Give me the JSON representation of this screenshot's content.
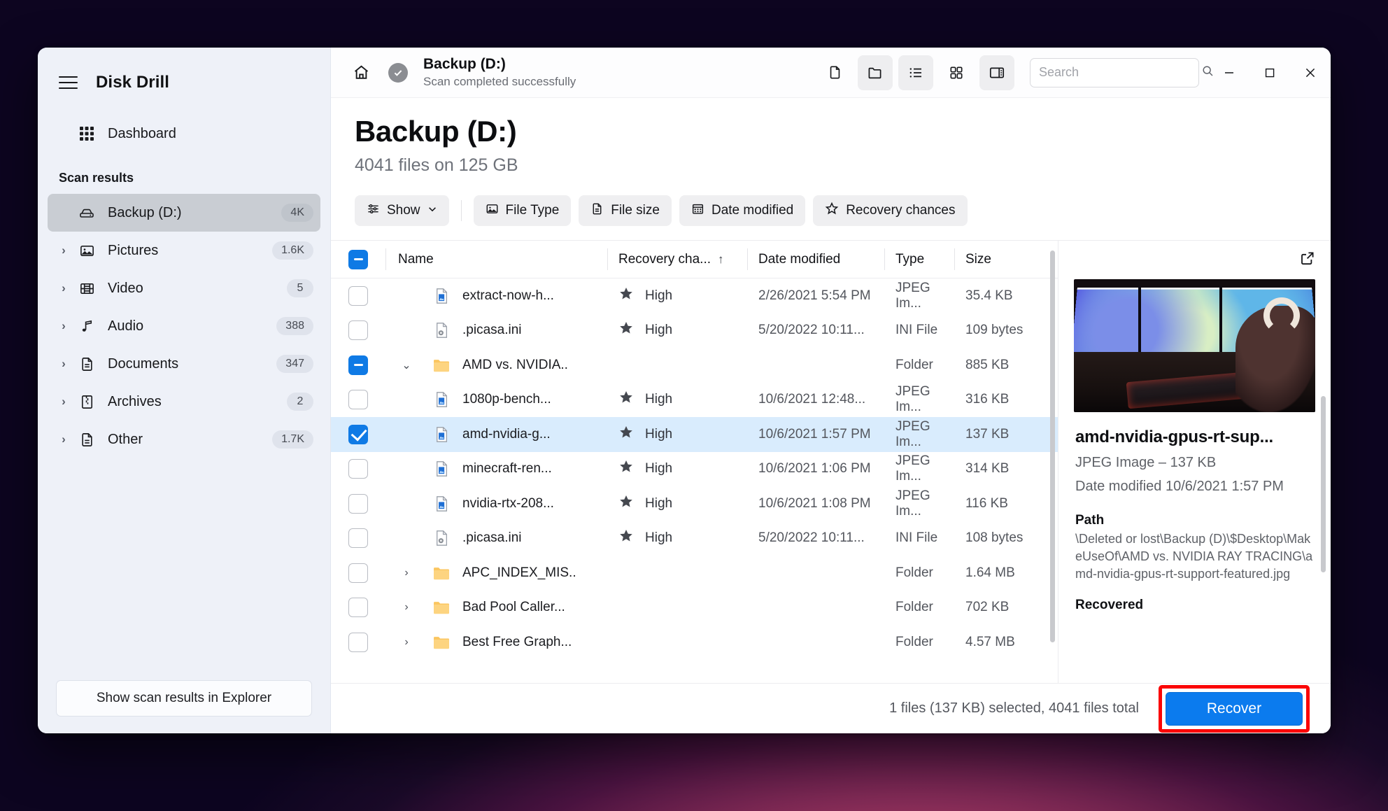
{
  "app": {
    "name": "Disk Drill"
  },
  "sidebar": {
    "dashboard_label": "Dashboard",
    "section_label": "Scan results",
    "items": [
      {
        "label": "Backup (D:)",
        "count": "4K",
        "icon": "drive-icon"
      },
      {
        "label": "Pictures",
        "count": "1.6K",
        "icon": "picture-icon"
      },
      {
        "label": "Video",
        "count": "5",
        "icon": "film-icon"
      },
      {
        "label": "Audio",
        "count": "388",
        "icon": "music-note-icon"
      },
      {
        "label": "Documents",
        "count": "347",
        "icon": "document-icon"
      },
      {
        "label": "Archives",
        "count": "2",
        "icon": "archive-icon"
      },
      {
        "label": "Other",
        "count": "1.7K",
        "icon": "file-icon"
      }
    ],
    "explorer_button": "Show scan results in Explorer"
  },
  "titlebar": {
    "breadcrumb_title": "Backup (D:)",
    "status": "Scan completed successfully",
    "view_buttons": [
      "file-view-icon",
      "folder-view-icon",
      "list-view-icon",
      "grid-view-icon",
      "preview-pane-icon"
    ],
    "window_controls": [
      "minimize",
      "maximize",
      "close"
    ]
  },
  "search": {
    "placeholder": "Search",
    "value": ""
  },
  "page": {
    "title": "Backup (D:)",
    "subtitle": "4041 files on 125 GB"
  },
  "filters": {
    "show_label": "Show",
    "buttons": [
      {
        "label": "File Type",
        "icon": "image-icon"
      },
      {
        "label": "File size",
        "icon": "document-icon"
      },
      {
        "label": "Date modified",
        "icon": "calendar-icon"
      },
      {
        "label": "Recovery chances",
        "icon": "star-icon"
      }
    ]
  },
  "table": {
    "columns": [
      "Name",
      "Recovery cha...",
      "Date modified",
      "Type",
      "Size"
    ],
    "sort_column": "Recovery cha...",
    "sort_direction": "ascending",
    "header_checkbox_state": "indeterminate",
    "rows": [
      {
        "checkbox": "unchecked",
        "expander": "",
        "icon": "jpeg-file-icon",
        "name": "extract-now-h...",
        "recovery": "High",
        "date": "2/26/2021 5:54 PM",
        "type": "JPEG Im...",
        "size": "35.4 KB",
        "selected": false
      },
      {
        "checkbox": "unchecked",
        "expander": "",
        "icon": "ini-file-icon",
        "name": ".picasa.ini",
        "recovery": "High",
        "date": "5/20/2022 10:11...",
        "type": "INI File",
        "size": "109 bytes",
        "selected": false
      },
      {
        "checkbox": "indeterminate",
        "expander": "down",
        "icon": "folder-icon",
        "name": "AMD vs. NVIDIA..",
        "recovery": "",
        "date": "",
        "type": "Folder",
        "size": "885 KB",
        "selected": false
      },
      {
        "checkbox": "unchecked",
        "expander": "",
        "icon": "jpeg-file-icon",
        "name": "1080p-bench...",
        "recovery": "High",
        "date": "10/6/2021 12:48...",
        "type": "JPEG Im...",
        "size": "316 KB",
        "selected": false
      },
      {
        "checkbox": "checked",
        "expander": "",
        "icon": "jpeg-file-icon",
        "name": "amd-nvidia-g...",
        "recovery": "High",
        "date": "10/6/2021 1:57 PM",
        "type": "JPEG Im...",
        "size": "137 KB",
        "selected": true
      },
      {
        "checkbox": "unchecked",
        "expander": "",
        "icon": "jpeg-file-icon",
        "name": "minecraft-ren...",
        "recovery": "High",
        "date": "10/6/2021 1:06 PM",
        "type": "JPEG Im...",
        "size": "314 KB",
        "selected": false
      },
      {
        "checkbox": "unchecked",
        "expander": "",
        "icon": "jpeg-file-icon",
        "name": "nvidia-rtx-208...",
        "recovery": "High",
        "date": "10/6/2021 1:08 PM",
        "type": "JPEG Im...",
        "size": "116 KB",
        "selected": false
      },
      {
        "checkbox": "unchecked",
        "expander": "",
        "icon": "ini-file-icon",
        "name": ".picasa.ini",
        "recovery": "High",
        "date": "5/20/2022 10:11...",
        "type": "INI File",
        "size": "108 bytes",
        "selected": false
      },
      {
        "checkbox": "unchecked",
        "expander": "right",
        "icon": "folder-icon",
        "name": "APC_INDEX_MIS..",
        "recovery": "",
        "date": "",
        "type": "Folder",
        "size": "1.64 MB",
        "selected": false
      },
      {
        "checkbox": "unchecked",
        "expander": "right",
        "icon": "folder-icon",
        "name": "Bad Pool Caller...",
        "recovery": "",
        "date": "",
        "type": "Folder",
        "size": "702 KB",
        "selected": false
      },
      {
        "checkbox": "unchecked",
        "expander": "right",
        "icon": "folder-icon",
        "name": "Best Free Graph...",
        "recovery": "",
        "date": "",
        "type": "Folder",
        "size": "4.57 MB",
        "selected": false
      }
    ]
  },
  "preview": {
    "name": "amd-nvidia-gpus-rt-sup...",
    "meta": "JPEG Image – 137 KB",
    "date": "Date modified 10/6/2021 1:57 PM",
    "path_heading": "Path",
    "path": "\\Deleted or lost\\Backup (D)\\$Desktop\\MakeUseOf\\AMD vs. NVIDIA RAY TRACING\\amd-nvidia-gpus-rt-support-featured.jpg",
    "next_heading": "Recovered"
  },
  "footer": {
    "status": "1 files (137 KB) selected, 4041 files total",
    "recover_label": "Recover",
    "highlight_color": "#fb0505",
    "accent_color": "#0b7bee"
  }
}
